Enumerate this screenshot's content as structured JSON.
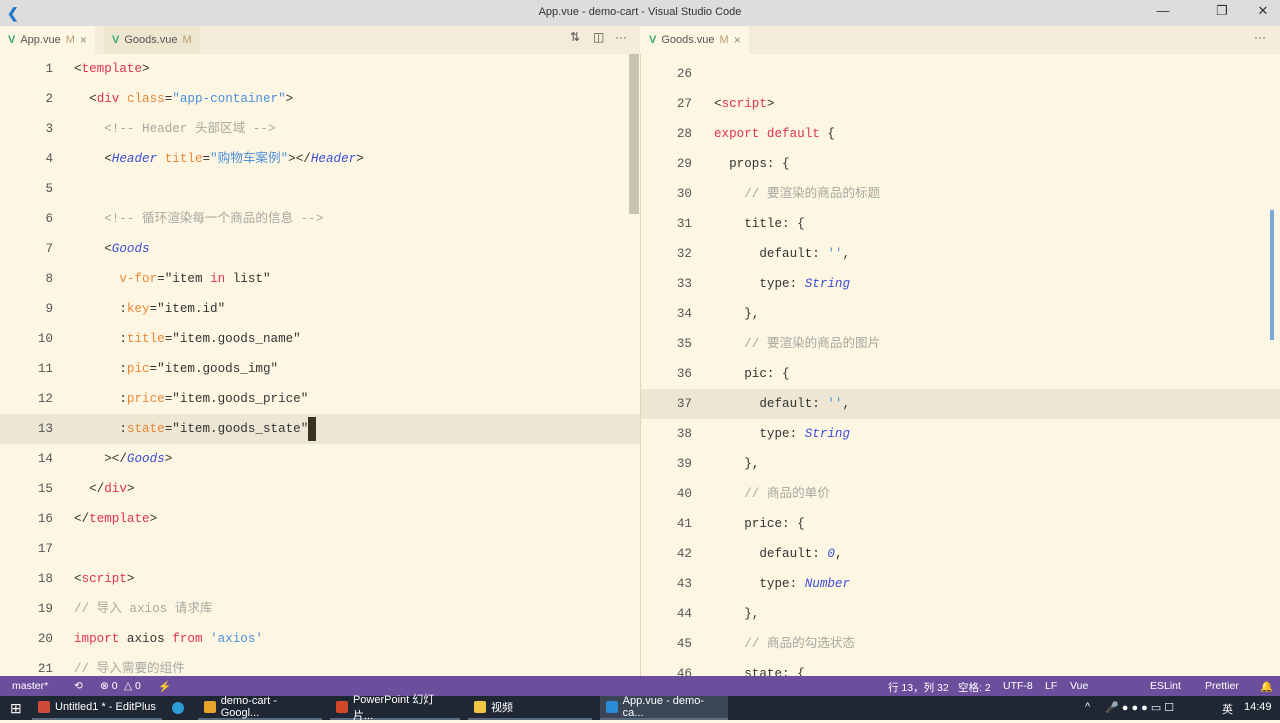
{
  "window": {
    "title": "App.vue - demo-cart - Visual Studio Code"
  },
  "left_tabs": [
    {
      "label": "App.vue",
      "badge": "M",
      "close": "×"
    },
    {
      "label": "Goods.vue",
      "badge": "M"
    }
  ],
  "right_tabs": [
    {
      "label": "Goods.vue",
      "badge": "M",
      "close": "×"
    }
  ],
  "left_code": [
    [
      1,
      [
        [
          "<",
          "p"
        ],
        [
          "template",
          "t"
        ],
        [
          ">",
          "p"
        ]
      ]
    ],
    [
      2,
      [
        [
          "  <",
          "p"
        ],
        [
          "div",
          "t"
        ],
        [
          " ",
          "p"
        ],
        [
          "class",
          "a"
        ],
        [
          "=",
          "p"
        ],
        [
          "\"app-container\"",
          "s"
        ],
        [
          ">",
          "p"
        ]
      ]
    ],
    [
      3,
      [
        [
          "    <!-- Header 头部区域 -->",
          "c"
        ]
      ]
    ],
    [
      4,
      [
        [
          "    <",
          "p"
        ],
        [
          "Header",
          "cmp"
        ],
        [
          " ",
          "p"
        ],
        [
          "title",
          "a"
        ],
        [
          "=",
          "p"
        ],
        [
          "\"购物车案例\"",
          "s"
        ],
        [
          "></",
          "p"
        ],
        [
          "Header",
          "cmp"
        ],
        [
          ">",
          "p"
        ]
      ]
    ],
    [
      5,
      []
    ],
    [
      6,
      [
        [
          "    <!-- 循环渲染每一个商品的信息 -->",
          "c"
        ]
      ]
    ],
    [
      7,
      [
        [
          "    <",
          "p"
        ],
        [
          "Goods",
          "cmp"
        ]
      ]
    ],
    [
      8,
      [
        [
          "      ",
          "p"
        ],
        [
          "v-for",
          "a"
        ],
        [
          "=\"item ",
          "p"
        ],
        [
          "in",
          "k"
        ],
        [
          " list\"",
          "p"
        ]
      ]
    ],
    [
      9,
      [
        [
          "      :",
          "p"
        ],
        [
          "key",
          "a"
        ],
        [
          "=\"item.id\"",
          "p"
        ]
      ]
    ],
    [
      10,
      [
        [
          "      :",
          "p"
        ],
        [
          "title",
          "a"
        ],
        [
          "=\"item.goods_name\"",
          "p"
        ]
      ]
    ],
    [
      11,
      [
        [
          "      :",
          "p"
        ],
        [
          "pic",
          "a"
        ],
        [
          "=\"item.goods_img\"",
          "p"
        ]
      ]
    ],
    [
      12,
      [
        [
          "      :",
          "p"
        ],
        [
          "price",
          "a"
        ],
        [
          "=\"item.goods_price\"",
          "p"
        ]
      ]
    ],
    [
      13,
      [
        [
          "      :",
          "p"
        ],
        [
          "state",
          "a"
        ],
        [
          "=\"item.goods_state\"",
          "p"
        ]
      ]
    ],
    [
      14,
      [
        [
          "    ></",
          "p"
        ],
        [
          "Goods",
          "cmp"
        ],
        [
          ">",
          "p"
        ]
      ]
    ],
    [
      15,
      [
        [
          "  </",
          "p"
        ],
        [
          "div",
          "t"
        ],
        [
          ">",
          "p"
        ]
      ]
    ],
    [
      16,
      [
        [
          "</",
          "p"
        ],
        [
          "template",
          "t"
        ],
        [
          ">",
          "p"
        ]
      ]
    ],
    [
      17,
      []
    ],
    [
      18,
      [
        [
          "<",
          "p"
        ],
        [
          "script",
          "t"
        ],
        [
          ">",
          "p"
        ]
      ]
    ],
    [
      19,
      [
        [
          "// 导入 axios 请求库",
          "c"
        ]
      ]
    ],
    [
      20,
      [
        [
          "import",
          "k"
        ],
        [
          " axios ",
          "p"
        ],
        [
          "from",
          "k"
        ],
        [
          " ",
          "p"
        ],
        [
          "'axios'",
          "s"
        ]
      ]
    ],
    [
      21,
      [
        [
          "// 导入需要的组件",
          "c"
        ]
      ]
    ]
  ],
  "right_code": [
    [
      26,
      []
    ],
    [
      27,
      [
        [
          "<",
          "p"
        ],
        [
          "script",
          "t"
        ],
        [
          ">",
          "p"
        ]
      ]
    ],
    [
      28,
      [
        [
          "export",
          "k"
        ],
        [
          " ",
          "p"
        ],
        [
          "default",
          "k"
        ],
        [
          " {",
          "p"
        ]
      ]
    ],
    [
      29,
      [
        [
          "  props: {",
          "p"
        ]
      ]
    ],
    [
      30,
      [
        [
          "    // 要渲染的商品的标题",
          "c"
        ]
      ]
    ],
    [
      31,
      [
        [
          "    title: {",
          "p"
        ]
      ]
    ],
    [
      32,
      [
        [
          "      default: ",
          "p"
        ],
        [
          "''",
          "s"
        ],
        [
          ",",
          "p"
        ]
      ]
    ],
    [
      33,
      [
        [
          "      type: ",
          "p"
        ],
        [
          "String",
          "n"
        ]
      ]
    ],
    [
      34,
      [
        [
          "    },",
          "p"
        ]
      ]
    ],
    [
      35,
      [
        [
          "    // 要渲染的商品的图片",
          "c"
        ]
      ]
    ],
    [
      36,
      [
        [
          "    pic: {",
          "p"
        ]
      ]
    ],
    [
      37,
      [
        [
          "      default: ",
          "p"
        ],
        [
          "''",
          "s"
        ],
        [
          ",",
          "p"
        ]
      ]
    ],
    [
      38,
      [
        [
          "      type: ",
          "p"
        ],
        [
          "String",
          "n"
        ]
      ]
    ],
    [
      39,
      [
        [
          "    },",
          "p"
        ]
      ]
    ],
    [
      40,
      [
        [
          "    // 商品的单价",
          "c"
        ]
      ]
    ],
    [
      41,
      [
        [
          "    price: {",
          "p"
        ]
      ]
    ],
    [
      42,
      [
        [
          "      default: ",
          "p"
        ],
        [
          "0",
          "n"
        ],
        [
          ",",
          "p"
        ]
      ]
    ],
    [
      43,
      [
        [
          "      type: ",
          "p"
        ],
        [
          "Number",
          "n"
        ]
      ]
    ],
    [
      44,
      [
        [
          "    },",
          "p"
        ]
      ]
    ],
    [
      45,
      [
        [
          "    // 商品的勾选状态",
          "c"
        ]
      ]
    ],
    [
      46,
      [
        [
          "    state: {",
          "p"
        ]
      ]
    ]
  ],
  "status": {
    "branch": "master*",
    "errors": "⊗ 0",
    "warnings": "△ 0",
    "position": "行 13，列 32",
    "spaces": "空格: 2",
    "encoding": "UTF-8",
    "eol": "LF",
    "language": "Vue",
    "eslint": "ESLint",
    "prettier": "Prettier"
  },
  "taskbar": {
    "items": [
      {
        "label": "Untitled1 * - EditPlus",
        "color": "#d04a3a"
      },
      {
        "label": "demo-cart - Googl...",
        "color": "#e6a42b"
      },
      {
        "label": "PowerPoint 幻灯片...",
        "color": "#d24726"
      },
      {
        "label": "视频",
        "color": "#f2c744"
      },
      {
        "label": "App.vue - demo-ca...",
        "color": "#2b8ad6"
      }
    ],
    "ime": "英",
    "time": "14:49"
  }
}
